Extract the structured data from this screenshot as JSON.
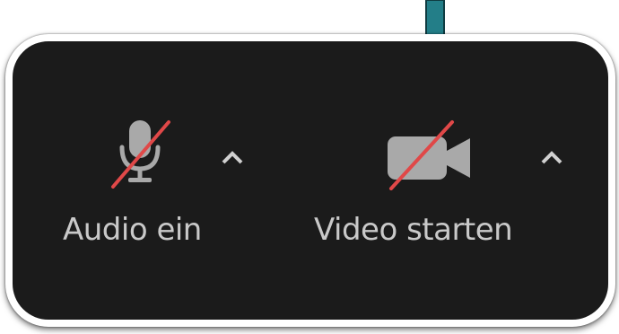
{
  "toolbar": {
    "audio": {
      "label": "Audio ein",
      "icon": "microphone-muted-icon",
      "menu_icon": "caret-up-icon"
    },
    "video": {
      "label": "Video starten",
      "icon": "video-camera-off-icon",
      "menu_icon": "caret-up-icon"
    }
  },
  "annotation": {
    "icon": "arrow-down-icon",
    "color": "#237e88"
  },
  "colors": {
    "panel_background": "#1b1b1b",
    "icon_gray": "#a9a9a9",
    "mute_slash": "#e04848",
    "label_text": "#c9c9c9"
  }
}
